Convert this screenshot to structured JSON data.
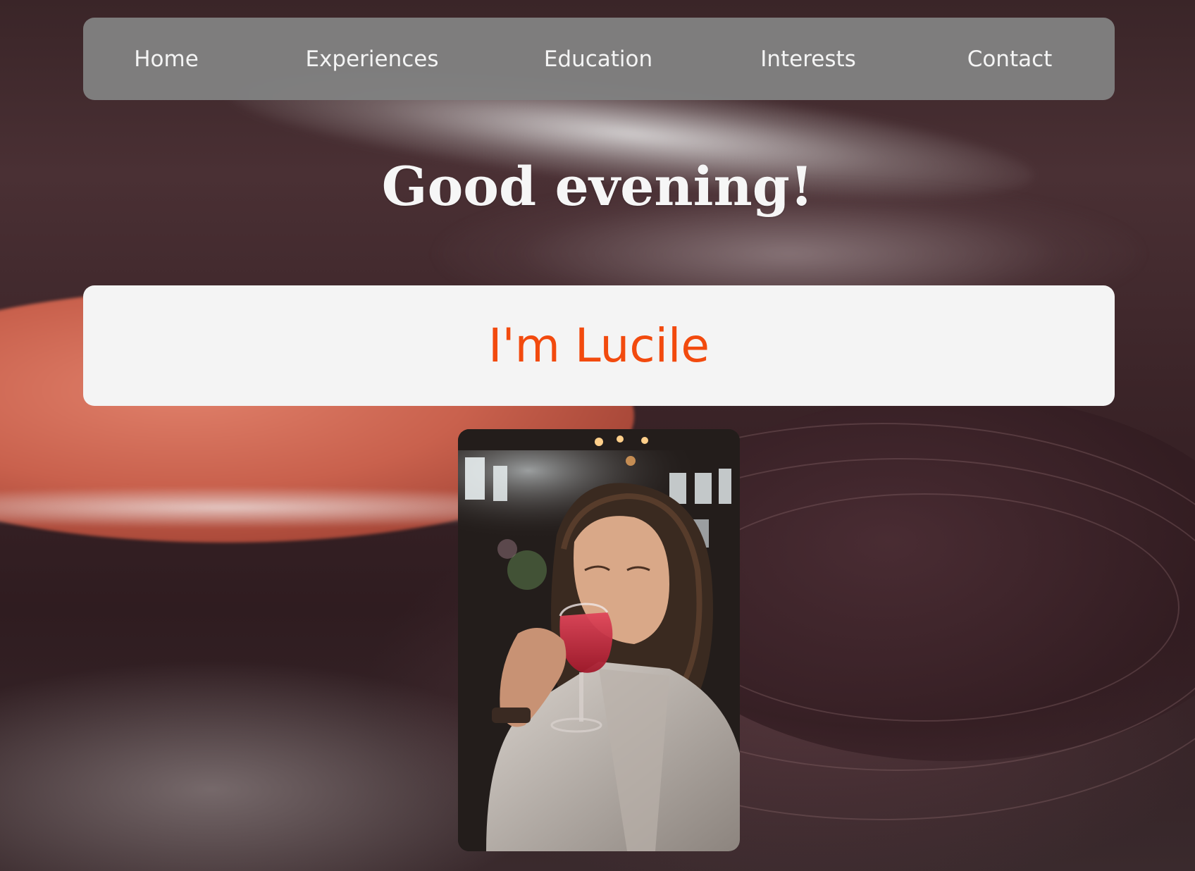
{
  "nav": {
    "items": [
      {
        "label": "Home"
      },
      {
        "label": "Experiences"
      },
      {
        "label": "Education"
      },
      {
        "label": "Interests"
      },
      {
        "label": "Contact"
      }
    ]
  },
  "hero": {
    "greeting": "Good evening!",
    "name": "I'm Lucile"
  },
  "colors": {
    "nav_background": "#808080",
    "nav_text": "#f4f4f4",
    "card_background": "#f4f4f4",
    "name_accent": "#f24a0e",
    "greeting_text": "#f6f6f6"
  },
  "images": {
    "background": "vinyl-record-photo",
    "portrait": "woman-drinking-red-wine-photo"
  }
}
